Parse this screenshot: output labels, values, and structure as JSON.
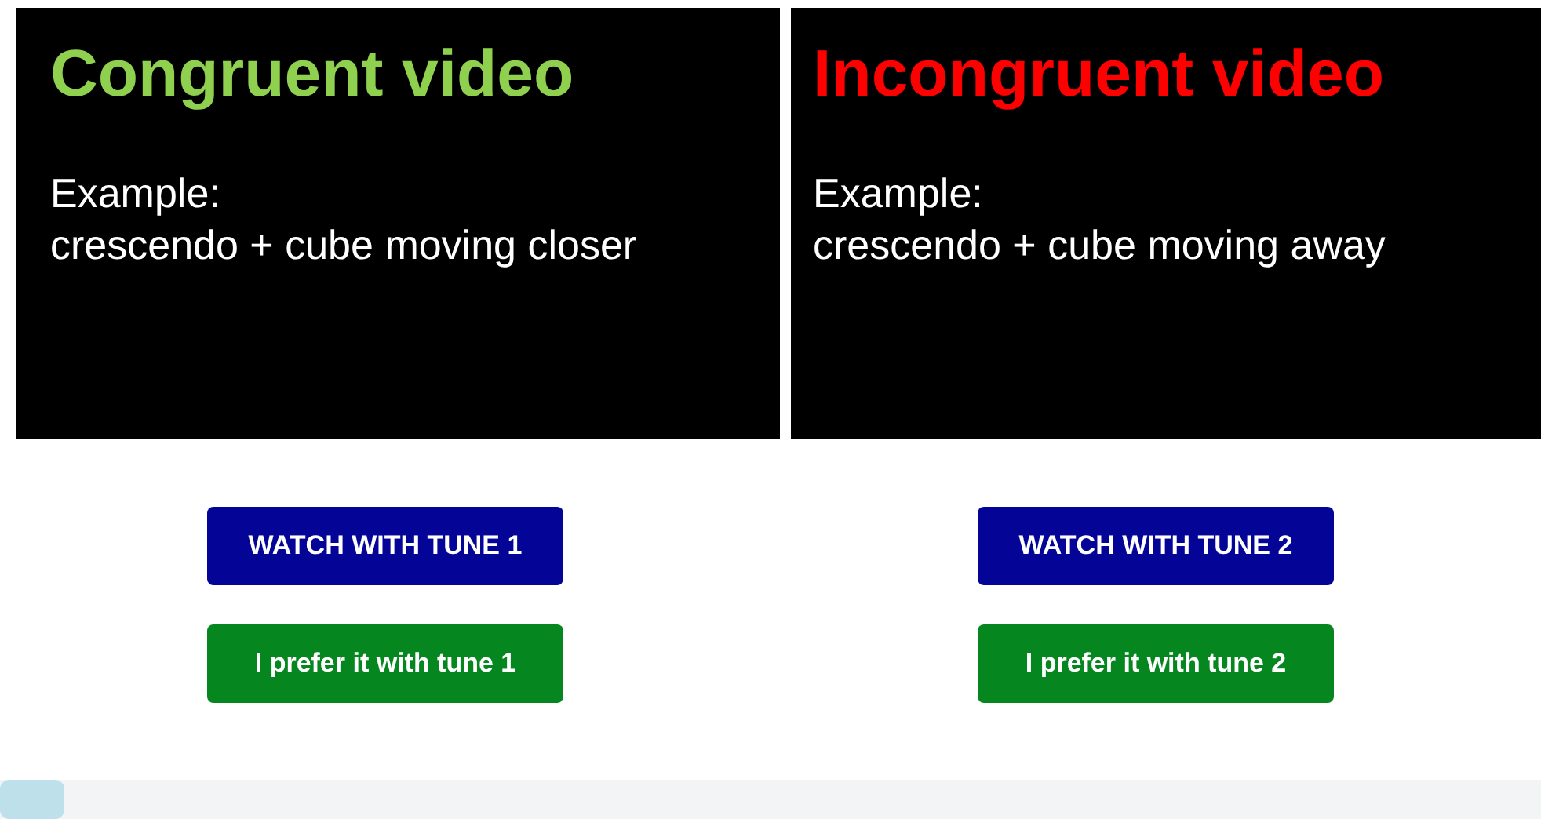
{
  "videos": [
    {
      "title": "Congruent video",
      "color": "#8fd14f",
      "lines": [
        "Example:",
        "crescendo + cube moving closer"
      ]
    },
    {
      "title": "Incongruent video",
      "color": "#ff0000",
      "lines": [
        "Example:",
        "crescendo + cube moving away"
      ]
    }
  ],
  "buttons": [
    {
      "watch": "WATCH WITH TUNE 1",
      "prefer": "I prefer it with tune 1"
    },
    {
      "watch": "WATCH WITH TUNE 2",
      "prefer": "I prefer it with tune 2"
    }
  ],
  "progress": {
    "level": 0.042
  }
}
